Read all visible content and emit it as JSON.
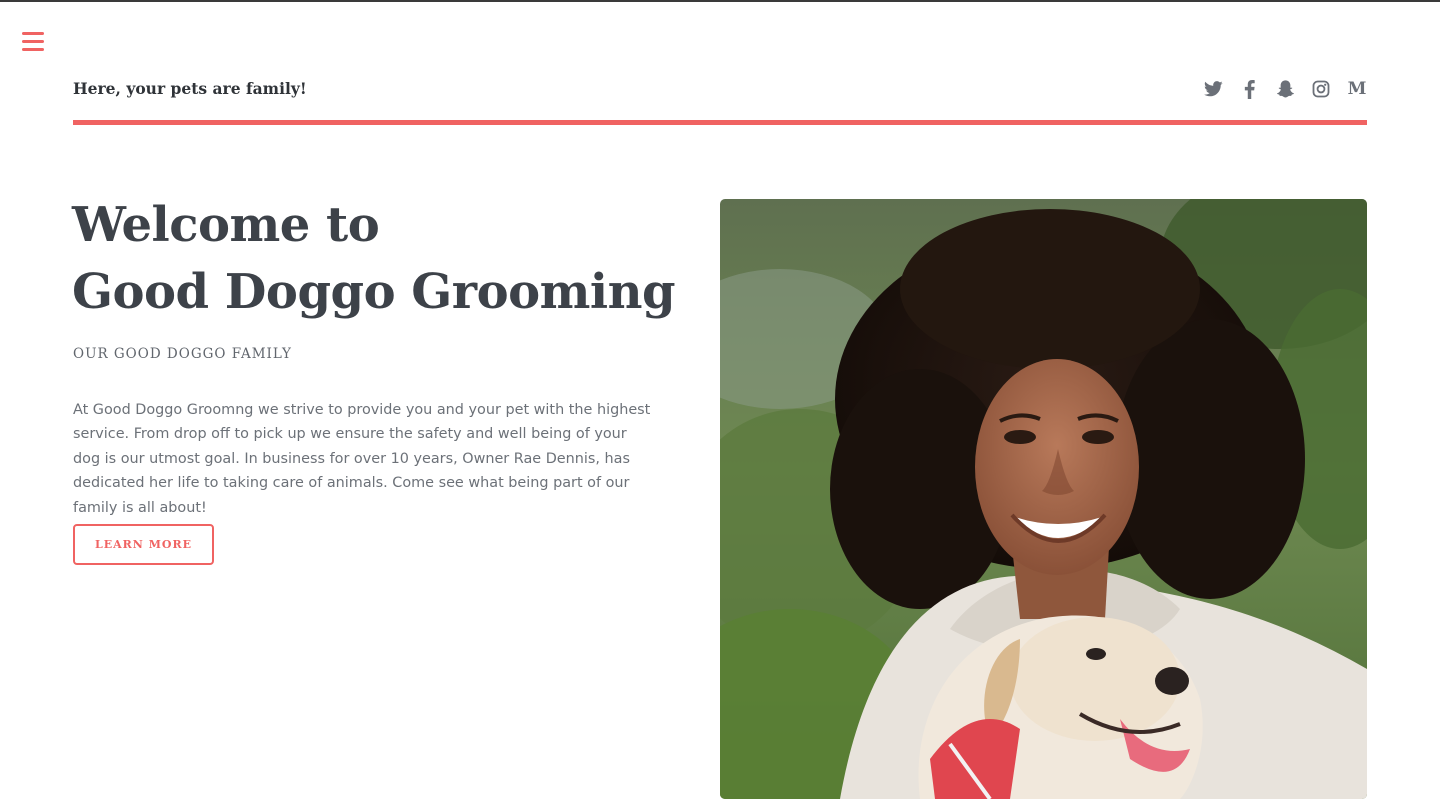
{
  "header": {
    "tagline": "Here, your pets are family!",
    "social": [
      {
        "icon": "twitter-icon"
      },
      {
        "icon": "facebook-icon"
      },
      {
        "icon": "snapchat-icon"
      },
      {
        "icon": "instagram-icon"
      },
      {
        "icon": "medium-icon",
        "glyph": "M"
      }
    ]
  },
  "hero": {
    "title_line1": "Welcome to",
    "title_line2": "Good Doggo Grooming",
    "eyebrow": "OUR GOOD DOGGO FAMILY",
    "body": "At Good Doggo Groomng we strive to provide you and your pet with the highest service. From drop off to pick up we ensure the safety and well being of your dog is our utmost goal. In business for over 10 years, Owner Rae Dennis, has dedicated her life to taking care of animals. Come see what being part of our family is all about!",
    "cta_label": "LEARN MORE"
  },
  "colors": {
    "accent": "#f06362",
    "heading": "#3d4249",
    "body_text": "#6c7178",
    "icon_gray": "#6b7078"
  }
}
